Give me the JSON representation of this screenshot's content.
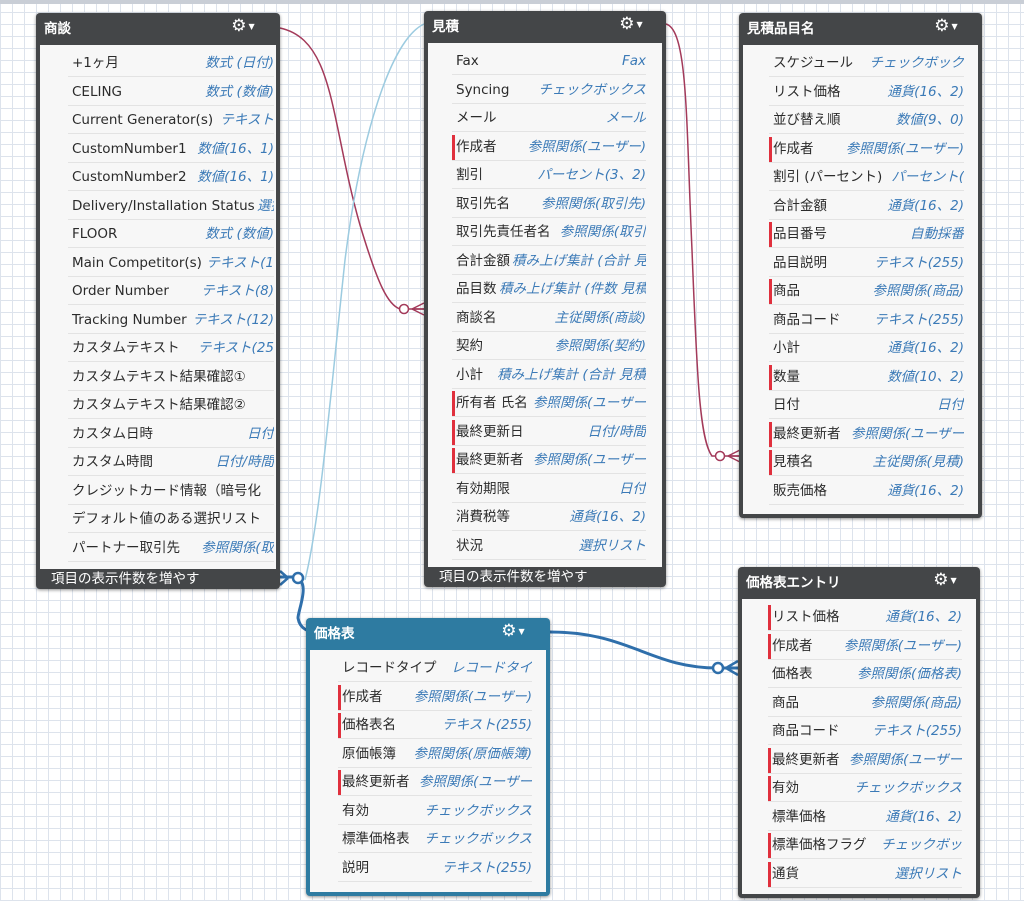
{
  "colors": {
    "card_header": "#444648",
    "card_header_selected": "#2e7ba1",
    "row_bg": "#f7f7f7",
    "field_type": "#3b7ab7",
    "required_marker": "#e0303d",
    "line_crimson": "#a33a5a",
    "line_lightblue": "#9ccbe0",
    "line_blue": "#2f6fab",
    "grid": "#dde3ec"
  },
  "icons": {
    "gear": "gear-icon",
    "caret": "caret-down-icon"
  },
  "cards": {
    "shodan": {
      "title": "商談",
      "footer": "項目の表示件数を増やす",
      "fields": [
        {
          "name": "+1ヶ月",
          "type": "数式 (日付)",
          "required": false
        },
        {
          "name": "CELING",
          "type": "数式 (数値)",
          "required": false
        },
        {
          "name": "Current Generator(s)",
          "type": "テキスト",
          "required": false
        },
        {
          "name": "CustomNumber1",
          "type": "数値(16、1)",
          "required": false
        },
        {
          "name": "CustomNumber2",
          "type": "数値(16、1)",
          "required": false
        },
        {
          "name": "Delivery/Installation Status",
          "type": "選択",
          "required": false
        },
        {
          "name": "FLOOR",
          "type": "数式 (数値)",
          "required": false
        },
        {
          "name": "Main Competitor(s)",
          "type": "テキスト(1",
          "required": false
        },
        {
          "name": "Order Number",
          "type": "テキスト(8)",
          "required": false
        },
        {
          "name": "Tracking Number",
          "type": "テキスト(12)",
          "required": false
        },
        {
          "name": "カスタムテキスト",
          "type": "テキスト(25",
          "required": false
        },
        {
          "name": "カスタムテキスト結果確認①",
          "type": "",
          "required": false
        },
        {
          "name": "カスタムテキスト結果確認②",
          "type": "",
          "required": false
        },
        {
          "name": "カスタム日時",
          "type": "日付",
          "required": false
        },
        {
          "name": "カスタム時間",
          "type": "日付/時間",
          "required": false
        },
        {
          "name": "クレジットカード情報（暗号化",
          "type": "",
          "required": false
        },
        {
          "name": "デフォルト値のある選択リスト",
          "type": "",
          "required": false
        },
        {
          "name": "パートナー取引先",
          "type": "参照関係(取",
          "required": false
        }
      ]
    },
    "mitsumori": {
      "title": "見積",
      "footer": "項目の表示件数を増やす",
      "fields": [
        {
          "name": "Fax",
          "type": "Fax",
          "required": false
        },
        {
          "name": "Syncing",
          "type": "チェックボックス",
          "required": false
        },
        {
          "name": "メール",
          "type": "メール",
          "required": false
        },
        {
          "name": "作成者",
          "type": "参照関係(ユーザー)",
          "required": true
        },
        {
          "name": "割引",
          "type": "パーセント(3、2)",
          "required": false
        },
        {
          "name": "取引先名",
          "type": "参照関係(取引先)",
          "required": false
        },
        {
          "name": "取引先責任者名",
          "type": "参照関係(取引",
          "required": false
        },
        {
          "name": "合計金額",
          "type": "積み上げ集計 (合計 見",
          "required": false
        },
        {
          "name": "品目数",
          "type": "積み上げ集計 (件数 見積",
          "required": false
        },
        {
          "name": "商談名",
          "type": "主従関係(商談)",
          "required": false
        },
        {
          "name": "契約",
          "type": "参照関係(契約)",
          "required": false
        },
        {
          "name": "小計",
          "type": "積み上げ集計 (合計 見積",
          "required": false
        },
        {
          "name": "所有者 氏名",
          "type": "参照関係(ユーザー",
          "required": true
        },
        {
          "name": "最終更新日",
          "type": "日付/時間",
          "required": true
        },
        {
          "name": "最終更新者",
          "type": "参照関係(ユーザー",
          "required": true
        },
        {
          "name": "有効期限",
          "type": "日付",
          "required": false
        },
        {
          "name": "消費税等",
          "type": "通貨(16、2)",
          "required": false
        },
        {
          "name": "状況",
          "type": "選択リスト",
          "required": false
        }
      ]
    },
    "mitsumori_hinmoku": {
      "title": "見積品目名",
      "footer": "",
      "fields": [
        {
          "name": "スケジュール",
          "type": "チェックボック",
          "required": false
        },
        {
          "name": "リスト価格",
          "type": "通貨(16、2)",
          "required": false
        },
        {
          "name": "並び替え順",
          "type": "数値(9、0)",
          "required": false
        },
        {
          "name": "作成者",
          "type": "参照関係(ユーザー)",
          "required": true
        },
        {
          "name": "割引 (パーセント)",
          "type": "パーセント(",
          "required": false
        },
        {
          "name": "合計金額",
          "type": "通貨(16、2)",
          "required": false
        },
        {
          "name": "品目番号",
          "type": "自動採番",
          "required": true
        },
        {
          "name": "品目説明",
          "type": "テキスト(255)",
          "required": false
        },
        {
          "name": "商品",
          "type": "参照関係(商品)",
          "required": true
        },
        {
          "name": "商品コード",
          "type": "テキスト(255)",
          "required": false
        },
        {
          "name": "小計",
          "type": "通貨(16、2)",
          "required": false
        },
        {
          "name": "数量",
          "type": "数値(10、2)",
          "required": true
        },
        {
          "name": "日付",
          "type": "日付",
          "required": false
        },
        {
          "name": "最終更新者",
          "type": "参照関係(ユーザー",
          "required": true
        },
        {
          "name": "見積名",
          "type": "主従関係(見積)",
          "required": true
        },
        {
          "name": "販売価格",
          "type": "通貨(16、2)",
          "required": false
        }
      ]
    },
    "kakakuhyo": {
      "title": "価格表",
      "footer": "",
      "fields": [
        {
          "name": "レコードタイプ",
          "type": "レコードタイ",
          "required": false
        },
        {
          "name": "作成者",
          "type": "参照関係(ユーザー)",
          "required": true
        },
        {
          "name": "価格表名",
          "type": "テキスト(255)",
          "required": true
        },
        {
          "name": "原価帳簿",
          "type": "参照関係(原価帳簿)",
          "required": false
        },
        {
          "name": "最終更新者",
          "type": "参照関係(ユーザー",
          "required": true
        },
        {
          "name": "有効",
          "type": "チェックボックス",
          "required": false
        },
        {
          "name": "標準価格表",
          "type": "チェックボックス",
          "required": false
        },
        {
          "name": "説明",
          "type": "テキスト(255)",
          "required": false
        }
      ]
    },
    "kakakuhyo_entry": {
      "title": "価格表エントリ",
      "footer": "",
      "fields": [
        {
          "name": "リスト価格",
          "type": "通貨(16、2)",
          "required": true
        },
        {
          "name": "作成者",
          "type": "参照関係(ユーザー)",
          "required": true
        },
        {
          "name": "価格表",
          "type": "参照関係(価格表)",
          "required": false
        },
        {
          "name": "商品",
          "type": "参照関係(商品)",
          "required": false
        },
        {
          "name": "商品コード",
          "type": "テキスト(255)",
          "required": false
        },
        {
          "name": "最終更新者",
          "type": "参照関係(ユーザー",
          "required": true
        },
        {
          "name": "有効",
          "type": "チェックボックス",
          "required": true
        },
        {
          "name": "標準価格",
          "type": "通貨(16、2)",
          "required": false
        },
        {
          "name": "標準価格フラグ",
          "type": "チェックボッ",
          "required": true
        },
        {
          "name": "通貨",
          "type": "選択リスト",
          "required": true
        }
      ]
    }
  }
}
